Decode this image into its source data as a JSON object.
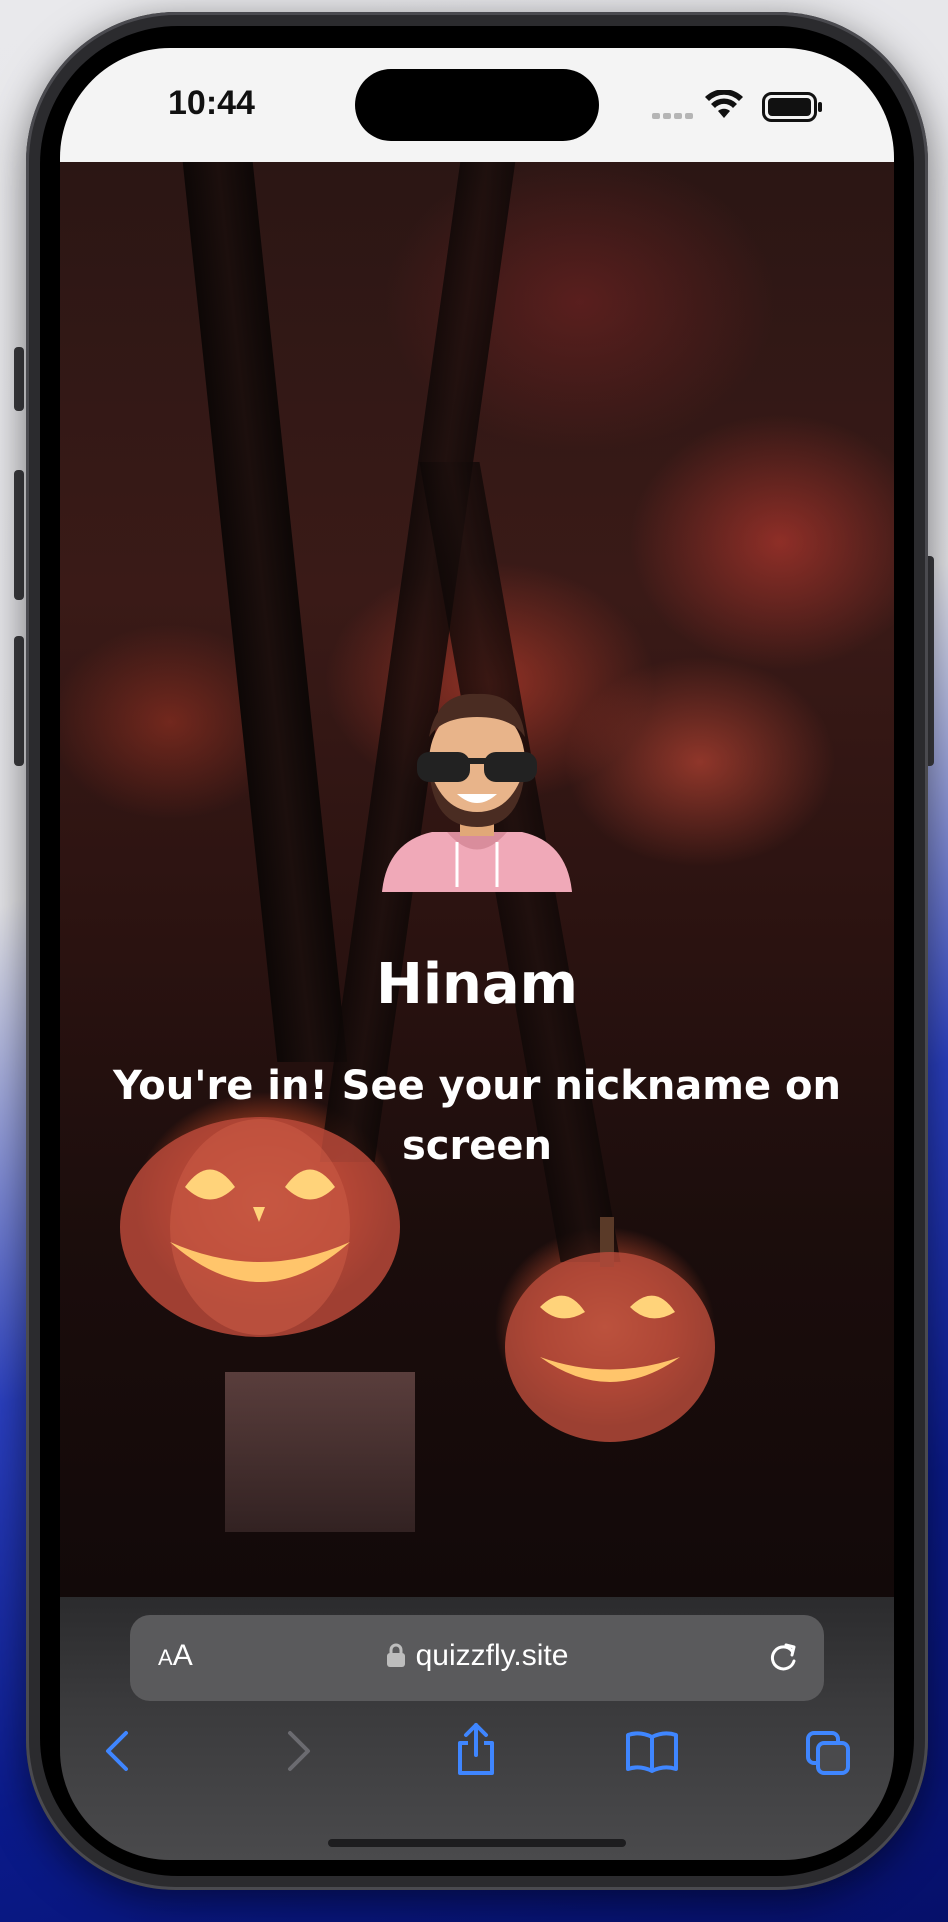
{
  "status_bar": {
    "time": "10:44"
  },
  "game": {
    "player_name": "Hinam",
    "message": "You're in! See your nickname on screen"
  },
  "browser": {
    "text_size_label_small": "A",
    "text_size_label_big": "A",
    "url": "quizzfly.site",
    "accent_color": "#3f86ff"
  },
  "icons": {
    "back": "chevron-left-icon",
    "forward": "chevron-right-icon",
    "share": "share-icon",
    "bookmarks": "book-icon",
    "tabs": "tabs-icon",
    "reload": "reload-icon",
    "lock": "lock-icon"
  }
}
